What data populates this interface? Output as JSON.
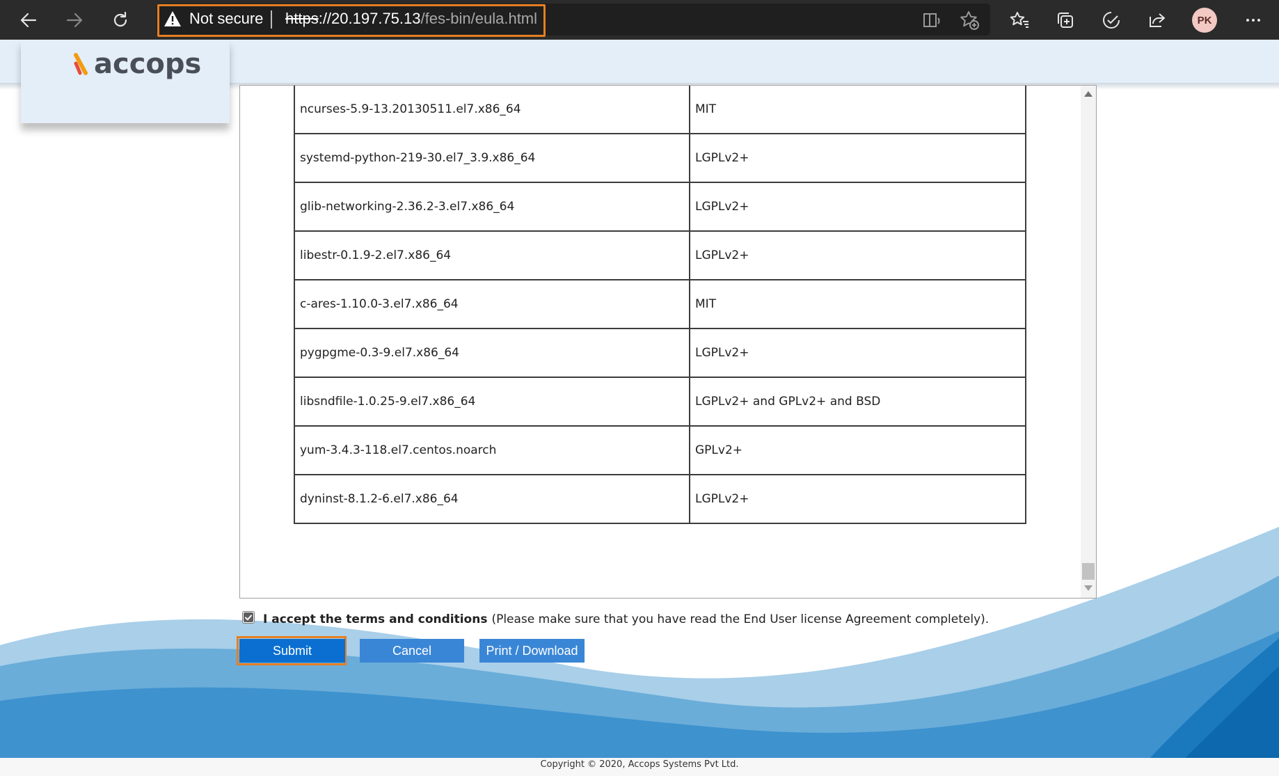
{
  "browser": {
    "security_label": "Not secure",
    "url_scheme": "https",
    "url_host": "://20.197.75.13",
    "url_path": "/fes-bin/eula.html",
    "profile_initials": "PK",
    "accent_highlight": "#e67e22"
  },
  "brand": {
    "logo_text": "accops",
    "logo_color": "#4a4f57",
    "mark_color": "#f39c12"
  },
  "eula": {
    "rows": [
      {
        "package": "ncurses-5.9-13.20130511.el7.x86_64",
        "license": "MIT"
      },
      {
        "package": "systemd-python-219-30.el7_3.9.x86_64",
        "license": "LGPLv2+"
      },
      {
        "package": "glib-networking-2.36.2-3.el7.x86_64",
        "license": "LGPLv2+"
      },
      {
        "package": "libestr-0.1.9-2.el7.x86_64",
        "license": "LGPLv2+"
      },
      {
        "package": "c-ares-1.10.0-3.el7.x86_64",
        "license": "MIT"
      },
      {
        "package": "pygpgme-0.3-9.el7.x86_64",
        "license": "LGPLv2+"
      },
      {
        "package": "libsndfile-1.0.25-9.el7.x86_64",
        "license": "LGPLv2+ and GPLv2+ and BSD"
      },
      {
        "package": "yum-3.4.3-118.el7.centos.noarch",
        "license": "GPLv2+"
      },
      {
        "package": "dyninst-8.1.2-6.el7.x86_64",
        "license": "LGPLv2+"
      }
    ]
  },
  "accept": {
    "checked": true,
    "label": "I accept the terms and conditions",
    "note": "(Please make sure that you have read the End User license Agreement completely)."
  },
  "buttons": {
    "submit": "Submit",
    "cancel": "Cancel",
    "print": "Print / Download"
  },
  "footer": {
    "copyright": "Copyright © 2020, Accops Systems Pvt Ltd."
  }
}
